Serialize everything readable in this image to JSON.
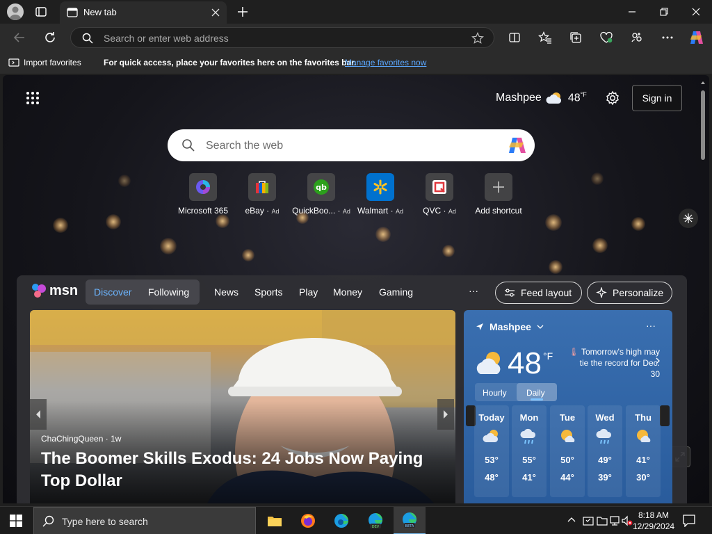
{
  "browser": {
    "tab_title": "New tab",
    "address_placeholder": "Search or enter web address"
  },
  "favorites_bar": {
    "import_label": "Import favorites",
    "message": "For quick access, place your favorites here on the favorites bar.",
    "manage_link": "Manage favorites now"
  },
  "newtab": {
    "location": "Mashpee",
    "temperature": "48",
    "unit": "°F",
    "sign_in": "Sign in",
    "search_placeholder": "Search the web",
    "shortcuts": [
      {
        "label": "Microsoft 365",
        "ad": ""
      },
      {
        "label": "eBay",
        "ad": "Ad"
      },
      {
        "label": "QuickBoo...",
        "ad": "Ad"
      },
      {
        "label": "Walmart",
        "ad": "Ad"
      },
      {
        "label": "QVC",
        "ad": "Ad"
      },
      {
        "label": "Add shortcut",
        "ad": ""
      }
    ]
  },
  "feed": {
    "brand": "msn",
    "tabs": [
      "Discover",
      "Following"
    ],
    "nav": [
      "News",
      "Sports",
      "Play",
      "Money",
      "Gaming"
    ],
    "more": "···",
    "feed_layout": "Feed layout",
    "personalize": "Personalize",
    "hero": {
      "source": "ChaChingQueen",
      "age": "1w",
      "headline": "The Boomer Skills Exodus: 24 Jobs Now Paying Top Dollar"
    },
    "weather": {
      "location": "Mashpee",
      "temp": "48",
      "unit": "°F",
      "alert": "Tomorrow's high may tie the record for Dec. 30",
      "toggle": [
        "Hourly",
        "Daily"
      ],
      "days": [
        {
          "name": "Today",
          "high": "53°",
          "low": "48°",
          "icon": "partly-cloudy-icon"
        },
        {
          "name": "Mon",
          "high": "55°",
          "low": "41°",
          "icon": "rain-icon"
        },
        {
          "name": "Tue",
          "high": "50°",
          "low": "44°",
          "icon": "sunny-cloud-icon"
        },
        {
          "name": "Wed",
          "high": "49°",
          "low": "39°",
          "icon": "rain-icon"
        },
        {
          "name": "Thu",
          "high": "41°",
          "low": "30°",
          "icon": "sunny-cloud-icon"
        }
      ]
    }
  },
  "taskbar": {
    "search_placeholder": "Type here to search",
    "time": "8:18 AM",
    "date": "12/29/2024"
  }
}
